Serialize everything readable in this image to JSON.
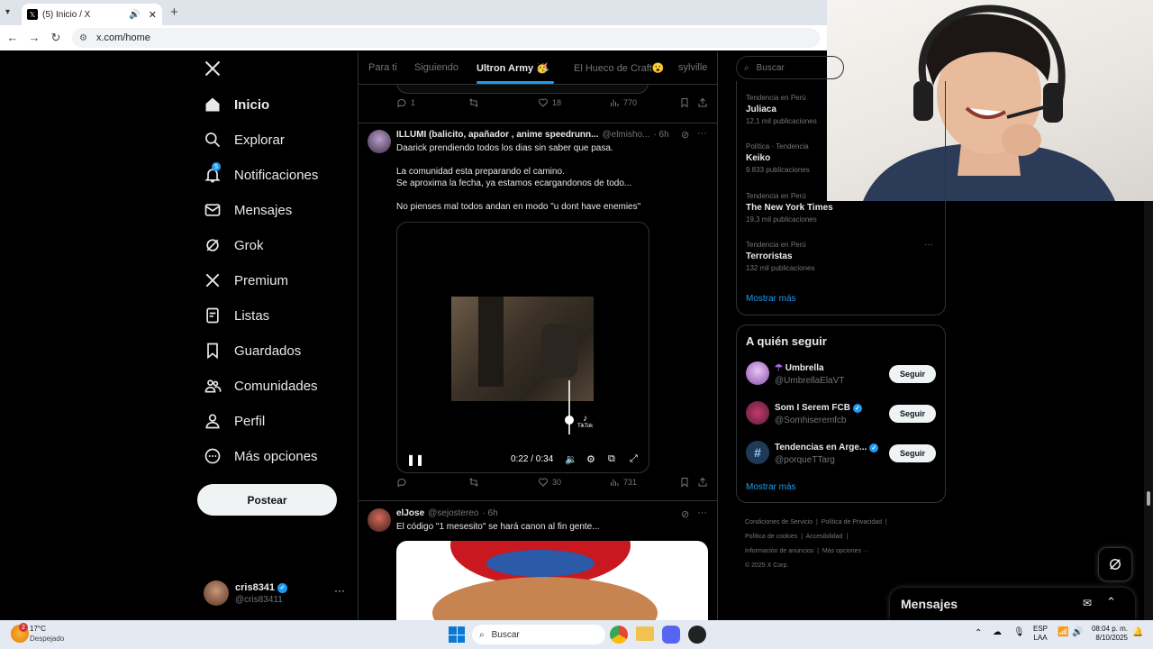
{
  "browser": {
    "tab_title": "(5) Inicio / X",
    "url": "x.com/home"
  },
  "nav": {
    "items": [
      {
        "label": "Inicio",
        "icon": "home-icon"
      },
      {
        "label": "Explorar",
        "icon": "search-icon"
      },
      {
        "label": "Notificaciones",
        "icon": "bell-icon",
        "badge": "5"
      },
      {
        "label": "Mensajes",
        "icon": "mail-icon"
      },
      {
        "label": "Grok",
        "icon": "grok-icon"
      },
      {
        "label": "Premium",
        "icon": "x-logo-icon"
      },
      {
        "label": "Listas",
        "icon": "list-icon"
      },
      {
        "label": "Guardados",
        "icon": "bookmark-icon"
      },
      {
        "label": "Comunidades",
        "icon": "communities-icon"
      },
      {
        "label": "Perfil",
        "icon": "person-icon"
      },
      {
        "label": "Más opciones",
        "icon": "more-circle-icon"
      }
    ],
    "post_label": "Postear",
    "account_name": "cris8341",
    "account_handle": "@cris83411"
  },
  "feed": {
    "tabs": [
      "Para ti",
      "Siguiendo",
      "Ultron Army 🥳",
      "El Hueco de Craft😮",
      "sylville"
    ],
    "top_actions": {
      "replies": "1",
      "reposts": "",
      "likes": "18",
      "views": "770"
    },
    "post1": {
      "author": "ILLUMI (balicito, apañador , anime speedrunn...",
      "handle": "@elmisho...",
      "time": "· 6h",
      "line1": "Daarick prendiendo todos los dias sin saber que pasa.",
      "line2": "La comunidad esta preparando el camino.",
      "line3": "Se aproxima la fecha, ya estamos ecargandonos de todo...",
      "line4": "No pienses mal todos andan en modo \"u dont have enemies\"",
      "video_time": "0:22 / 0:34",
      "tiktok_label": "TikTok",
      "actions": {
        "replies": "",
        "reposts": "",
        "likes": "30",
        "views": "731"
      }
    },
    "post2": {
      "author": "elJose",
      "handle": "@sejostereo",
      "time": "· 6h",
      "text": "El código \"1 mesesito\" se hará canon al fin gente..."
    }
  },
  "right": {
    "search_placeholder": "Buscar",
    "trends": [
      {
        "context": "Tendencia en Perú",
        "name": "Juliaca",
        "count": "12,1 mil publicaciones"
      },
      {
        "context": "Política · Tendencia",
        "name": "Keiko",
        "count": "9.833 publicaciones"
      },
      {
        "context": "Tendencia en Perú",
        "name": "The New York Times",
        "count": "19,3 mil publicaciones"
      },
      {
        "context": "Tendencia en Perú",
        "name": "Terroristas",
        "count": "132 mil publicaciones"
      }
    ],
    "show_more": "Mostrar más",
    "who_to_follow_title": "A quién seguir",
    "follow": [
      {
        "name": "Umbrella",
        "handle": "@UmbrellaElaVT",
        "button": "Seguir",
        "verified": false
      },
      {
        "name": "Som I Serem FCB",
        "handle": "@Somhiseremfcb",
        "button": "Seguir",
        "verified": true
      },
      {
        "name": "Tendencias en Arge...",
        "handle": "@porqueTTarg",
        "button": "Seguir",
        "verified": true
      }
    ],
    "follow_more": "Mostrar más",
    "footer": {
      "l1a": "Condiciones de Servicio",
      "l1b": "Política de Privacidad",
      "l2a": "Política de cookies",
      "l2b": "Accesibilidad",
      "l3a": "Información de anuncios",
      "l3b": "Más opciones ···",
      "l4": "© 2025 X Corp."
    },
    "messages_label": "Mensajes"
  },
  "taskbar": {
    "weather_temp": "17°C",
    "weather_desc": "Despejado",
    "search_label": "Buscar",
    "lang1": "ESP",
    "lang2": "LAA",
    "time": "08:04 p. m.",
    "date": "8/10/2025",
    "notif_count": "2"
  },
  "colors": {
    "accent": "#1d9bf0",
    "background": "#000000",
    "border": "#2f3336",
    "muted": "#71767b"
  }
}
